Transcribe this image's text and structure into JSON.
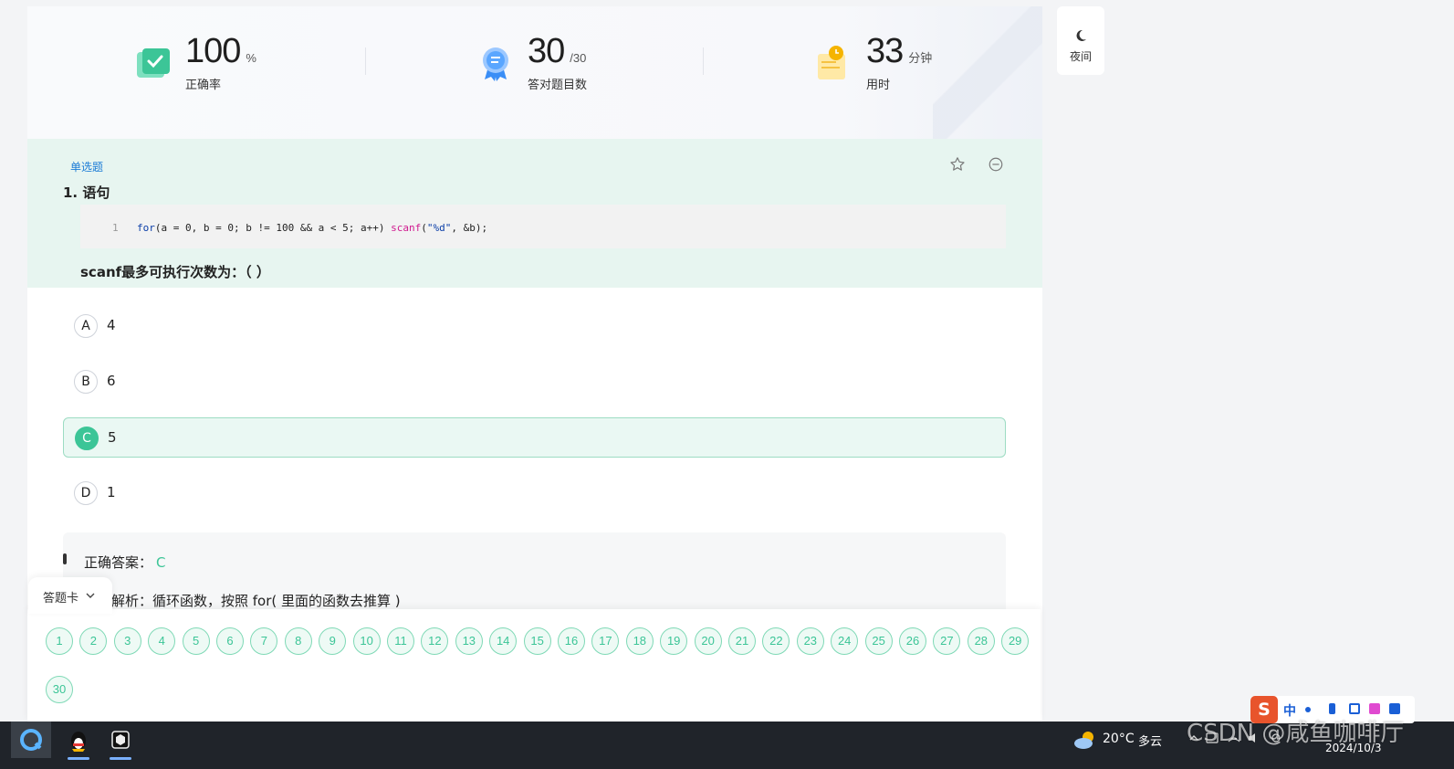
{
  "stats": [
    {
      "value": "100",
      "unit": "%",
      "label": "正确率"
    },
    {
      "value": "30",
      "unit": "/30",
      "label": "答对题目数"
    },
    {
      "value": "33",
      "unit": "分钟",
      "label": "用时"
    }
  ],
  "night_mode": {
    "label": "夜间"
  },
  "question": {
    "type_tag": "单选题",
    "title": "1. 语句",
    "code_line_number": "1",
    "code": {
      "kw": "for",
      "p1": "(a = 0, b = 0; b != 100 && a < 5; a++) ",
      "fn": "scanf",
      "p2": "(",
      "str": "\"%d\"",
      "p3": ", &b);"
    },
    "tail": "scanf最多可执行次数为：（ ）"
  },
  "options": [
    {
      "letter": "A",
      "text": "4",
      "selected": false
    },
    {
      "letter": "B",
      "text": "6",
      "selected": false
    },
    {
      "letter": "C",
      "text": "5",
      "selected": true
    },
    {
      "letter": "D",
      "text": "1",
      "selected": false
    }
  ],
  "analysis": {
    "answer_label": "正确答案：",
    "answer_value": "C",
    "explanation": "解析：循环函数，按照 for( 里面的函数去推算 )"
  },
  "answer_card": {
    "tab_label": "答题卡",
    "numbers": [
      "1",
      "2",
      "3",
      "4",
      "5",
      "6",
      "7",
      "8",
      "9",
      "10",
      "11",
      "12",
      "13",
      "14",
      "15",
      "16",
      "17",
      "18",
      "19",
      "20",
      "21",
      "22",
      "23",
      "24",
      "25",
      "26",
      "27",
      "28",
      "29",
      "30"
    ]
  },
  "colors": {
    "accent": "#3cc597",
    "question_bg": "#e7f5f0",
    "tag_blue": "#1a7bd6"
  },
  "taskbar": {
    "weather_temp": "20°C",
    "weather_cond": "多云",
    "date": "2024/10/3",
    "ime_lang": "中"
  },
  "watermark": "CSDN @咸鱼咖啡厅"
}
